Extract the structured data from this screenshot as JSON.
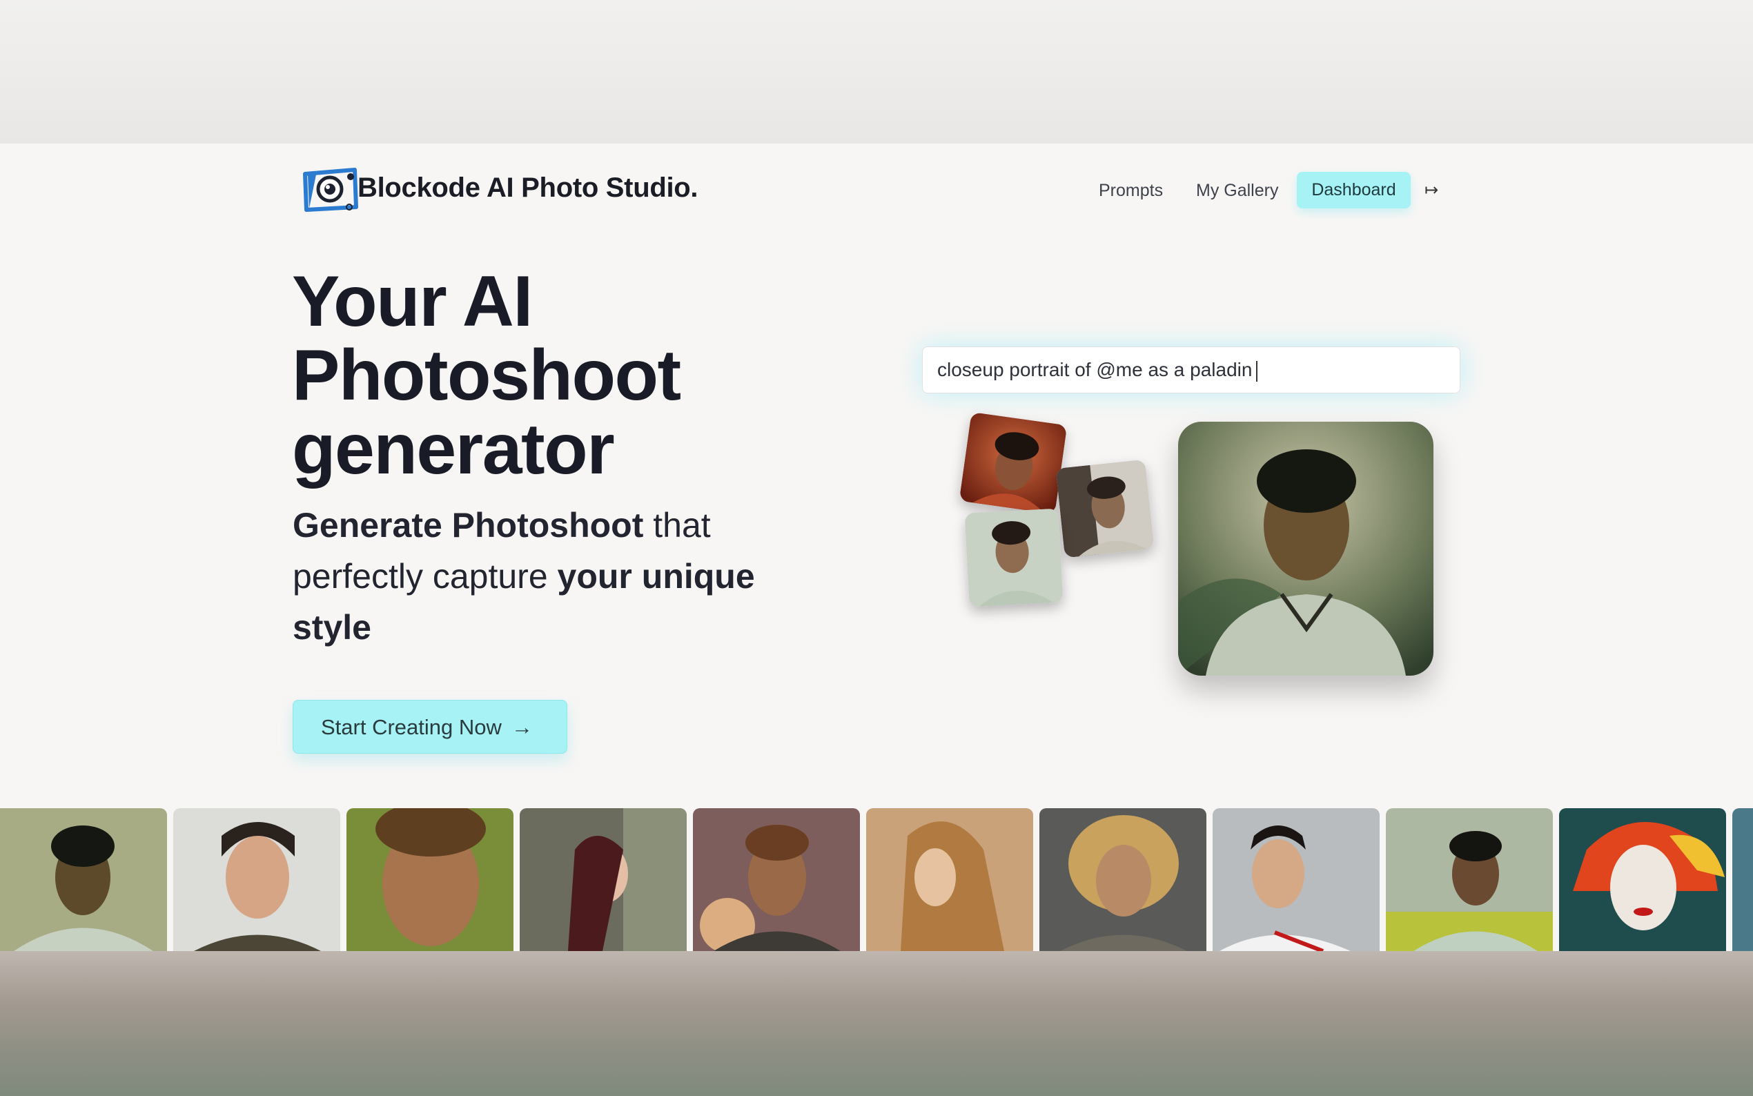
{
  "header": {
    "brand": "Blockode AI Photo Studio.",
    "logo_icon": "camera-lens-icon",
    "nav": [
      {
        "label": "Prompts"
      },
      {
        "label": "My Gallery"
      },
      {
        "label": "Dashboard",
        "active": true
      }
    ],
    "logout_icon": "↦",
    "accent_color": "#a6f2f5"
  },
  "hero": {
    "title_line1": "Your AI",
    "title_line2": "Photoshoot",
    "title_line3": "generator",
    "sub_bold1": "Generate Photoshoot",
    "sub_plain1": " that",
    "sub_plain2": "perfectly capture ",
    "sub_bold2": "your unique",
    "sub_bold3": "style",
    "cta_label": "Start Creating Now",
    "cta_arrow": "→"
  },
  "demo": {
    "prompt_text": "closeup portrait of @me as a paladin"
  },
  "gallery": {
    "items": [
      "portrait-1",
      "portrait-2",
      "portrait-3",
      "portrait-4",
      "portrait-5",
      "portrait-6",
      "portrait-7",
      "portrait-8",
      "portrait-9",
      "portrait-10",
      "portrait-11"
    ]
  }
}
